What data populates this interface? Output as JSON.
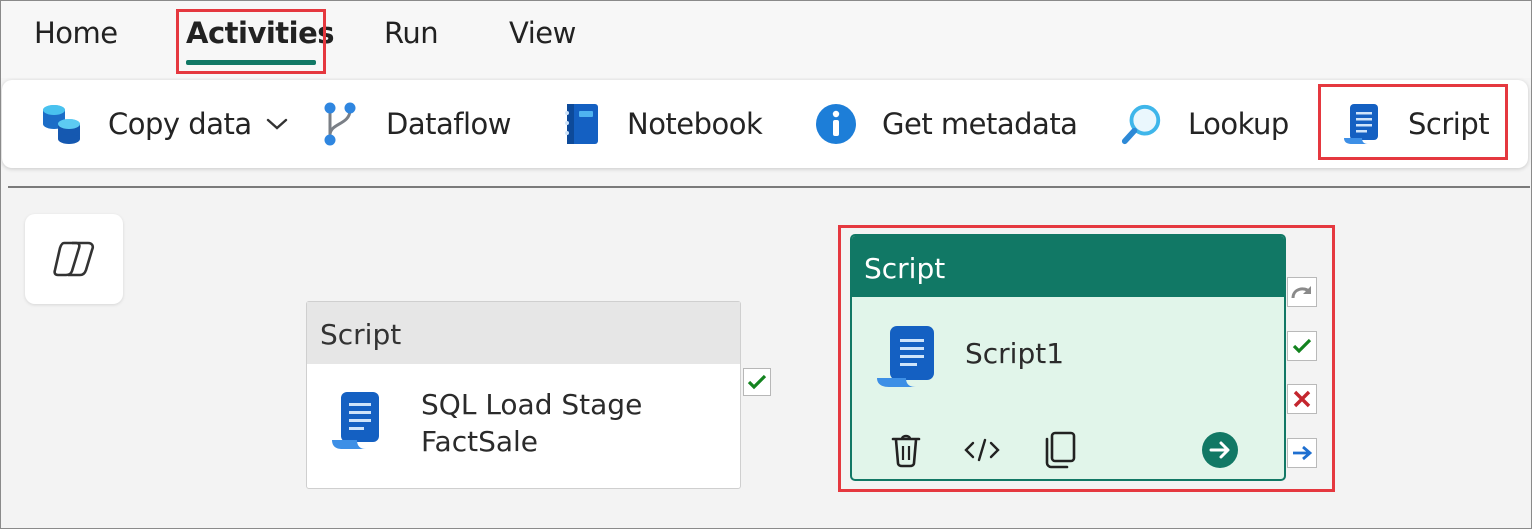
{
  "tabs": [
    {
      "label": "Home"
    },
    {
      "label": "Activities",
      "active": true
    },
    {
      "label": "Run"
    },
    {
      "label": "View"
    }
  ],
  "ribbon": {
    "copy_data": "Copy data",
    "dataflow": "Dataflow",
    "notebook": "Notebook",
    "get_metadata": "Get metadata",
    "lookup": "Lookup",
    "script": "Script"
  },
  "canvas": {
    "activity1": {
      "type": "Script",
      "name": "SQL Load Stage FactSale"
    },
    "activity2": {
      "type": "Script",
      "name": "Script1",
      "selected": true
    }
  },
  "colors": {
    "accent": "#117865",
    "highlight": "#e5383f",
    "selected_bg": "#e1f5ea",
    "icon_blue": "#1e6fd0"
  },
  "icons": [
    "database-icon",
    "chevron-down-icon",
    "dataflow-branch-icon",
    "notebook-icon",
    "info-icon",
    "search-icon",
    "script-icon",
    "copilot-icon",
    "checkmark-icon",
    "delete-icon",
    "code-icon",
    "copy-icon",
    "go-arrow-icon",
    "skip-icon",
    "fail-icon",
    "complete-arrow-icon"
  ]
}
